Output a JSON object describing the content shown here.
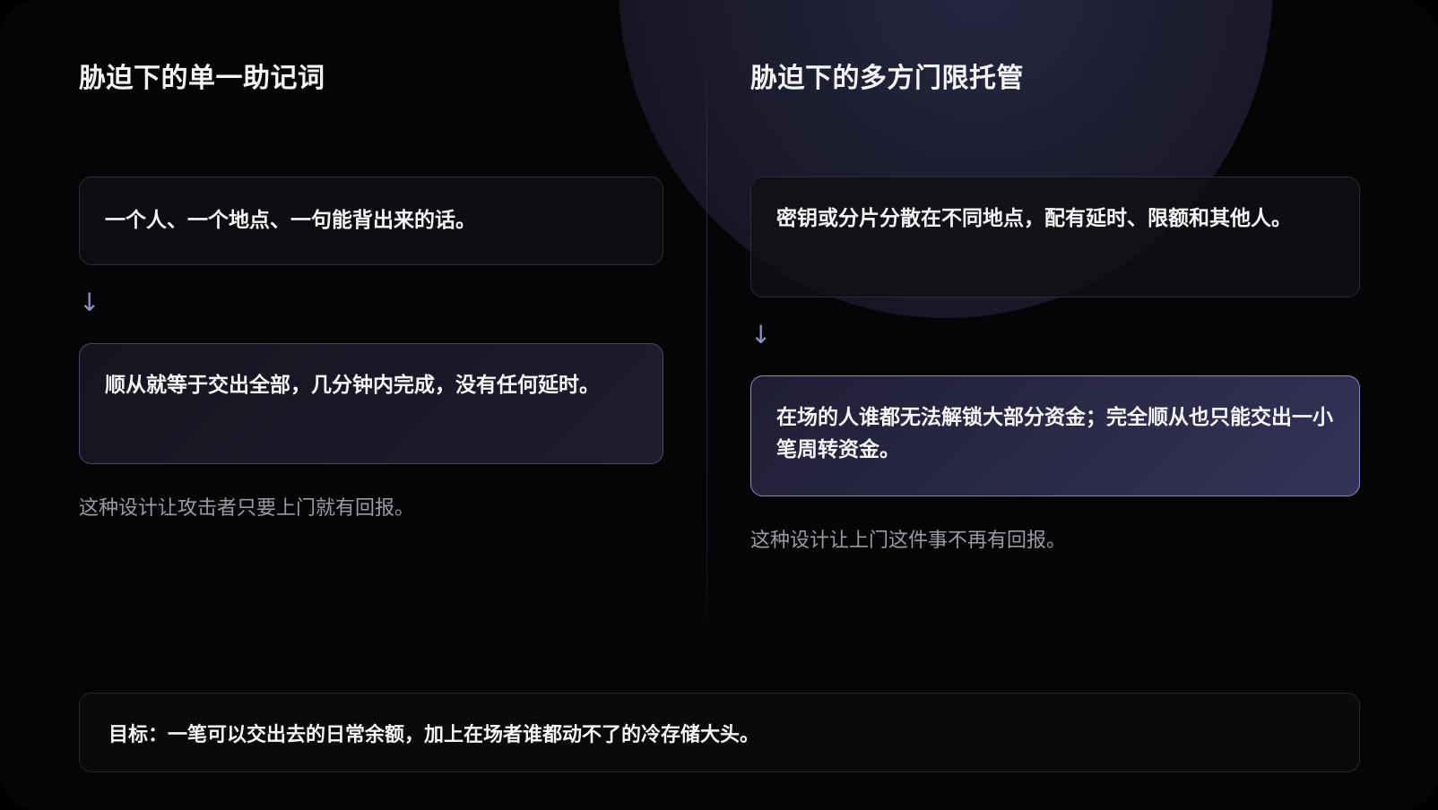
{
  "left": {
    "title": "胁迫下的单一助记词",
    "premise": "一个人、一个地点、一句能背出来的话。",
    "arrow": "↓",
    "outcome": "顺从就等于交出全部，几分钟内完成，没有任何延时。",
    "note": "这种设计让攻击者只要上门就有回报。"
  },
  "right": {
    "title": "胁迫下的多方门限托管",
    "premise": "密钥或分片分散在不同地点，配有延时、限额和其他人。",
    "arrow": "↓",
    "outcome": "在场的人谁都无法解锁大部分资金；完全顺从也只能交出一小笔周转资金。",
    "note": "这种设计让上门这件事不再有回报。"
  },
  "goal": "目标：一笔可以交出去的日常余额，加上在场者谁都动不了的冷存储大头。"
}
